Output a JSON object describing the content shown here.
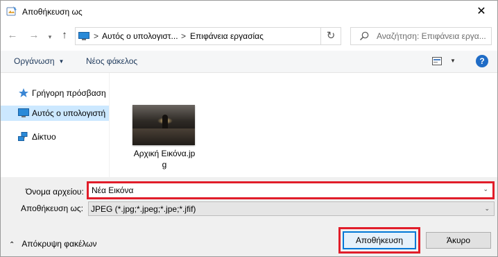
{
  "window": {
    "title": "Αποθήκευση ως",
    "close_glyph": "✕"
  },
  "nav": {
    "back_glyph": "←",
    "forward_glyph": "→",
    "dropdown_glyph": "▾",
    "up_glyph": "↑",
    "breadcrumb": [
      {
        "label": "Αυτός ο υπολογιστ..."
      },
      {
        "label": "Επιφάνεια εργασίας"
      }
    ],
    "separator_glyph": ">",
    "address_dropdown_glyph": "▾",
    "refresh_glyph": "↻",
    "search_placeholder": "Αναζήτηση: Επιφάνεια εργα..."
  },
  "toolbar": {
    "organize_label": "Οργάνωση",
    "organize_caret": "▼",
    "new_folder_label": "Νέος φάκελος",
    "view_caret": "▼",
    "help_label": "?"
  },
  "sidebar": {
    "items": [
      {
        "label": "Γρήγορη πρόσβαση",
        "icon": "star-icon"
      },
      {
        "label": "Αυτός ο υπολογιστή",
        "icon": "computer-icon",
        "selected": true
      },
      {
        "label": "Δίκτυο",
        "icon": "network-icon"
      }
    ]
  },
  "files": [
    {
      "name_line1": "Αρχική Εικόνα.jp",
      "name_line2": "g",
      "icon": "image-thumbnail"
    }
  ],
  "fields": {
    "filename_label": "Όνομα αρχείου:",
    "filename_value": "Νέα Εικόνα",
    "filetype_label": "Αποθήκευση ως:",
    "filetype_value": "JPEG (*.jpg;*.jpeg;*.jpe;*.jfif)",
    "caret_glyph": "⌄"
  },
  "footer": {
    "hide_folders_glyph": "⌃",
    "hide_folders_label": "Απόκρυψη φακέλων",
    "save_label": "Αποθήκευση",
    "cancel_label": "Άκυρο"
  },
  "colors": {
    "accent": "#0078d7",
    "highlight": "#e11d2a",
    "selection": "#cce8ff"
  }
}
